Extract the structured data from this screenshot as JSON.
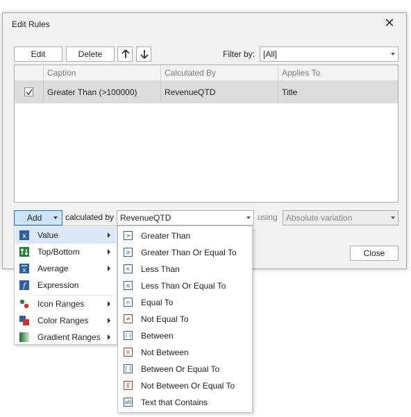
{
  "dialog": {
    "title": "Edit Rules",
    "close_glyph": "✕"
  },
  "toolbar": {
    "edit_label": "Edit",
    "delete_label": "Delete",
    "move_up_icon": "arrow-up-icon",
    "move_down_icon": "arrow-down-icon",
    "filter_label": "Filter by:",
    "filter_value": "[All]"
  },
  "grid": {
    "columns": [
      "Caption",
      "Calculated By",
      "Applies To"
    ],
    "rows": [
      {
        "checked": true,
        "caption": "Greater Than (>100000)",
        "calculated_by": "RevenueQTD",
        "applies_to": "Title"
      }
    ]
  },
  "bottom": {
    "add_label": "Add",
    "calculated_by_label": "calculated by",
    "calculated_by_value": "RevenueQTD",
    "using_label": "using",
    "using_value": "Absolute variation",
    "close_label": "Close"
  },
  "add_menu": {
    "items": [
      {
        "label": "Value",
        "icon": "value-icon",
        "has_submenu": true,
        "selected": true
      },
      {
        "label": "Top/Bottom",
        "icon": "top-bottom-icon",
        "has_submenu": true
      },
      {
        "label": "Average",
        "icon": "average-icon",
        "has_submenu": true
      },
      {
        "label": "Expression",
        "icon": "expression-icon",
        "has_submenu": false
      },
      {
        "label": "Icon Ranges",
        "icon": "icon-ranges-icon",
        "has_submenu": true
      },
      {
        "label": "Color Ranges",
        "icon": "color-ranges-icon",
        "has_submenu": true
      },
      {
        "label": "Gradient Ranges",
        "icon": "gradient-ranges-icon",
        "has_submenu": true
      }
    ]
  },
  "value_submenu": {
    "items": [
      {
        "label": "Greater Than",
        "glyph": ">"
      },
      {
        "label": "Greater Than Or Equal To",
        "glyph": "≥"
      },
      {
        "label": "Less Than",
        "glyph": "<"
      },
      {
        "label": "Less Than Or Equal To",
        "glyph": "≤"
      },
      {
        "label": "Equal To",
        "glyph": "="
      },
      {
        "label": "Not Equal To",
        "glyph": "≠"
      },
      {
        "label": "Between",
        "glyph": "( )"
      },
      {
        "label": "Not Between",
        "glyph": ")("
      },
      {
        "label": "Between Or Equal To",
        "glyph": "[ ]"
      },
      {
        "label": "Not Between Or Equal To",
        "glyph": "]["
      },
      {
        "label": "Text that Contains",
        "glyph": "ab"
      }
    ]
  },
  "colors": {
    "accent": "#2e6fbf",
    "selection": "#dcdcdc",
    "menu_highlight": "#dbe8f7"
  }
}
